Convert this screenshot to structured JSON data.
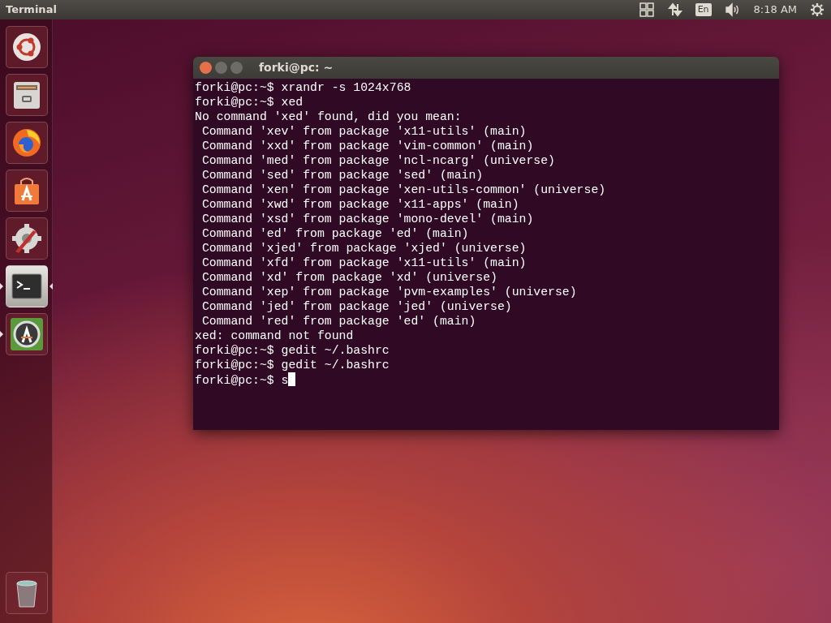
{
  "top_panel": {
    "title": "Terminal",
    "language": "En",
    "time": "8:18 AM"
  },
  "launcher": {
    "items": [
      {
        "kind": "dash",
        "running": false,
        "focused": false
      },
      {
        "kind": "files",
        "running": false,
        "focused": false
      },
      {
        "kind": "firefox",
        "running": false,
        "focused": false
      },
      {
        "kind": "software",
        "running": false,
        "focused": false
      },
      {
        "kind": "settings",
        "running": false,
        "focused": false
      },
      {
        "kind": "terminal",
        "running": true,
        "focused": true
      },
      {
        "kind": "updater",
        "running": true,
        "focused": false
      }
    ],
    "trash": {
      "kind": "trash"
    }
  },
  "terminal": {
    "title": "forki@pc: ~",
    "cursor": true,
    "lines": [
      "forki@pc:~$ xrandr -s 1024x768",
      "forki@pc:~$ xed",
      "No command 'xed' found, did you mean:",
      " Command 'xev' from package 'x11-utils' (main)",
      " Command 'xxd' from package 'vim-common' (main)",
      " Command 'med' from package 'ncl-ncarg' (universe)",
      " Command 'sed' from package 'sed' (main)",
      " Command 'xen' from package 'xen-utils-common' (universe)",
      " Command 'xwd' from package 'x11-apps' (main)",
      " Command 'xsd' from package 'mono-devel' (main)",
      " Command 'ed' from package 'ed' (main)",
      " Command 'xjed' from package 'xjed' (universe)",
      " Command 'xfd' from package 'x11-utils' (main)",
      " Command 'xd' from package 'xd' (universe)",
      " Command 'xep' from package 'pvm-examples' (universe)",
      " Command 'jed' from package 'jed' (universe)",
      " Command 'red' from package 'ed' (main)",
      "xed: command not found",
      "forki@pc:~$ gedit ~/.bashrc",
      "forki@pc:~$ gedit ~/.bashrc",
      "forki@pc:~$ s"
    ]
  }
}
